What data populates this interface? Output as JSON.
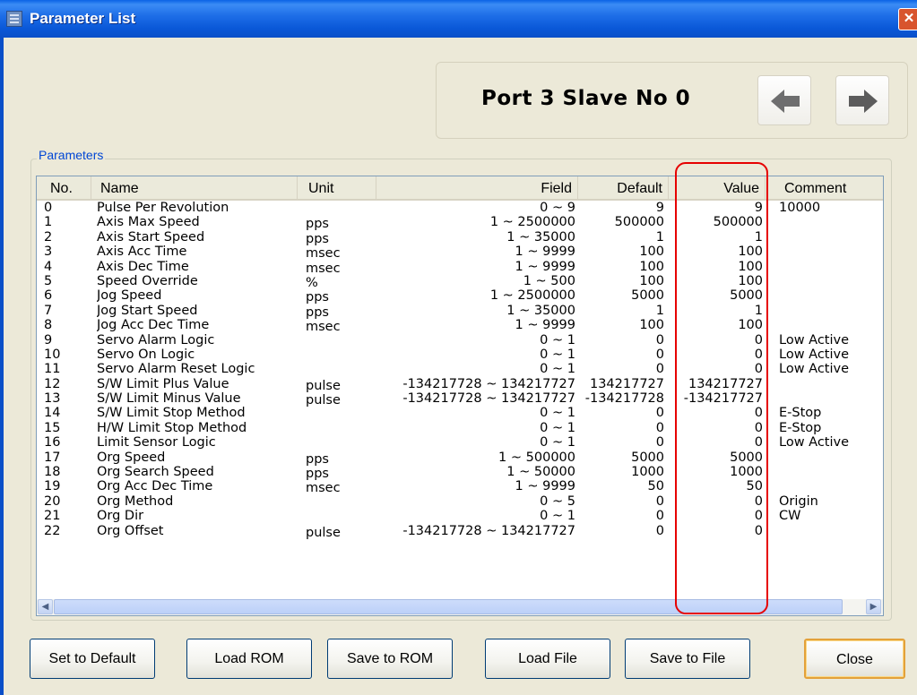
{
  "window": {
    "title": "Parameter List",
    "close_glyph": "✕"
  },
  "header": {
    "port_label": "Port 3 Slave No 0"
  },
  "parameters": {
    "group_title": "Parameters",
    "columns": {
      "no": "No.",
      "name": "Name",
      "unit": "Unit",
      "field": "Field",
      "default": "Default",
      "value": "Value",
      "comment": "Comment"
    },
    "rows": [
      {
        "no": "0",
        "name": "Pulse Per Revolution",
        "unit": "",
        "field": "0 ~ 9",
        "default": "9",
        "value": "9",
        "comment": "10000"
      },
      {
        "no": "1",
        "name": "Axis Max Speed",
        "unit": "pps",
        "field": "1 ~ 2500000",
        "default": "500000",
        "value": "500000",
        "comment": ""
      },
      {
        "no": "2",
        "name": "Axis Start Speed",
        "unit": "pps",
        "field": "1 ~ 35000",
        "default": "1",
        "value": "1",
        "comment": ""
      },
      {
        "no": "3",
        "name": "Axis Acc Time",
        "unit": "msec",
        "field": "1 ~ 9999",
        "default": "100",
        "value": "100",
        "comment": ""
      },
      {
        "no": "4",
        "name": "Axis Dec Time",
        "unit": "msec",
        "field": "1 ~ 9999",
        "default": "100",
        "value": "100",
        "comment": ""
      },
      {
        "no": "5",
        "name": "Speed Override",
        "unit": "%",
        "field": "1 ~ 500",
        "default": "100",
        "value": "100",
        "comment": ""
      },
      {
        "no": "6",
        "name": "Jog Speed",
        "unit": "pps",
        "field": "1 ~ 2500000",
        "default": "5000",
        "value": "5000",
        "comment": ""
      },
      {
        "no": "7",
        "name": "Jog Start Speed",
        "unit": "pps",
        "field": "1 ~ 35000",
        "default": "1",
        "value": "1",
        "comment": ""
      },
      {
        "no": "8",
        "name": "Jog Acc Dec Time",
        "unit": "msec",
        "field": "1 ~ 9999",
        "default": "100",
        "value": "100",
        "comment": ""
      },
      {
        "no": "9",
        "name": "Servo Alarm Logic",
        "unit": "",
        "field": "0 ~ 1",
        "default": "0",
        "value": "0",
        "comment": "Low Active"
      },
      {
        "no": "10",
        "name": "Servo On Logic",
        "unit": "",
        "field": "0 ~ 1",
        "default": "0",
        "value": "0",
        "comment": "Low Active"
      },
      {
        "no": "11",
        "name": "Servo Alarm Reset Logic",
        "unit": "",
        "field": "0 ~ 1",
        "default": "0",
        "value": "0",
        "comment": "Low Active"
      },
      {
        "no": "12",
        "name": "S/W Limit Plus Value",
        "unit": "pulse",
        "field": "-134217728 ~ 134217727",
        "default": "134217727",
        "value": "134217727",
        "comment": ""
      },
      {
        "no": "13",
        "name": "S/W Limit Minus Value",
        "unit": "pulse",
        "field": "-134217728 ~ 134217727",
        "default": "-134217728",
        "value": "-134217727",
        "comment": ""
      },
      {
        "no": "14",
        "name": "S/W Limit Stop Method",
        "unit": "",
        "field": "0 ~ 1",
        "default": "0",
        "value": "0",
        "comment": "E-Stop"
      },
      {
        "no": "15",
        "name": "H/W Limit Stop Method",
        "unit": "",
        "field": "0 ~ 1",
        "default": "0",
        "value": "0",
        "comment": "E-Stop"
      },
      {
        "no": "16",
        "name": "Limit Sensor Logic",
        "unit": "",
        "field": "0 ~ 1",
        "default": "0",
        "value": "0",
        "comment": "Low Active"
      },
      {
        "no": "17",
        "name": "Org Speed",
        "unit": "pps",
        "field": "1 ~ 500000",
        "default": "5000",
        "value": "5000",
        "comment": ""
      },
      {
        "no": "18",
        "name": "Org Search Speed",
        "unit": "pps",
        "field": "1 ~ 50000",
        "default": "1000",
        "value": "1000",
        "comment": ""
      },
      {
        "no": "19",
        "name": "Org Acc Dec Time",
        "unit": "msec",
        "field": "1 ~ 9999",
        "default": "50",
        "value": "50",
        "comment": ""
      },
      {
        "no": "20",
        "name": "Org Method",
        "unit": "",
        "field": "0 ~ 5",
        "default": "0",
        "value": "0",
        "comment": "Origin"
      },
      {
        "no": "21",
        "name": "Org Dir",
        "unit": "",
        "field": "0 ~ 1",
        "default": "0",
        "value": "0",
        "comment": "CW"
      },
      {
        "no": "22",
        "name": "Org Offset",
        "unit": "pulse",
        "field": "-134217728 ~ 134217727",
        "default": "0",
        "value": "0",
        "comment": ""
      }
    ]
  },
  "buttons": {
    "set_default": "Set to Default",
    "load_rom": "Load ROM",
    "save_rom": "Save to ROM",
    "load_file": "Load File",
    "save_file": "Save to File",
    "close": "Close"
  },
  "icons": {
    "prev": "left-arrow-icon",
    "next": "right-arrow-icon",
    "highlight_color": "#e60000"
  }
}
